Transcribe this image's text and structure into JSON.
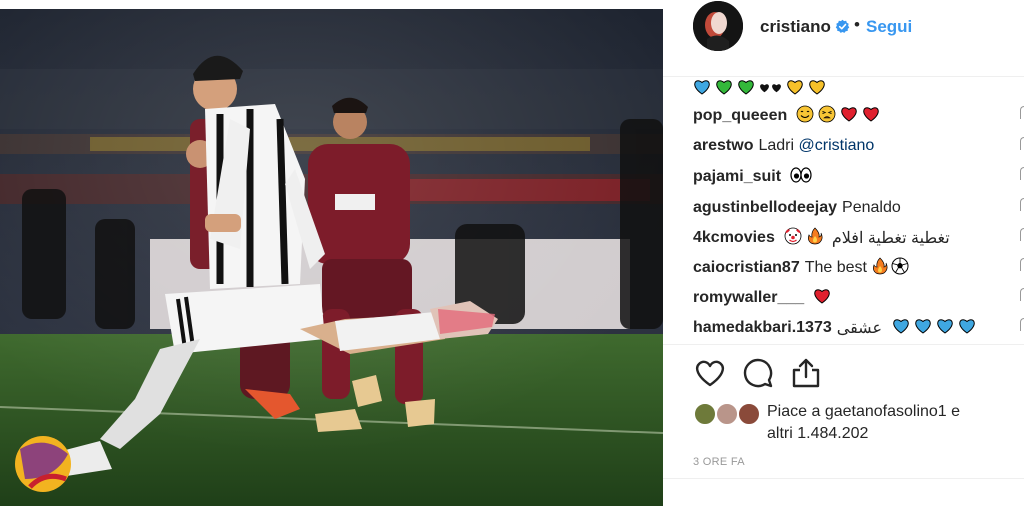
{
  "header": {
    "username": "cristiano",
    "separator": "•",
    "follow_label": "Segui"
  },
  "comments": [
    {
      "user": "",
      "text": "",
      "emojis": [
        "blue-heart",
        "green-heart",
        "green-heart",
        "black-heart",
        "black-heart",
        "yellow-heart",
        "yellow-heart"
      ]
    },
    {
      "user": "pop_queeen",
      "text": "",
      "emojis": [
        "grin-face",
        "weary-face",
        "red-heart",
        "red-heart"
      ]
    },
    {
      "user": "arestwo",
      "text": "Ladri ",
      "mention": "@cristiano",
      "emojis": []
    },
    {
      "user": "pajami_suit",
      "text": "",
      "emojis": [
        "eyes"
      ]
    },
    {
      "user": "agustinbellodeejay",
      "text": "Penaldo",
      "emojis": []
    },
    {
      "user": "4kcmovies",
      "text": "تغطية تغطية افلام",
      "emojis": [
        "clown-face",
        "fire"
      ]
    },
    {
      "user": "caiocristian87",
      "text": "The best",
      "emojis": [
        "fire",
        "soccer-ball"
      ]
    },
    {
      "user": "romywaller___",
      "text": "",
      "emojis": [
        "red-heart"
      ]
    },
    {
      "user": "hamedakbari.1373",
      "text": "عشقی",
      "emojis": [
        "blue-heart",
        "blue-heart",
        "blue-heart",
        "blue-heart"
      ]
    }
  ],
  "actions": {
    "like_icon": "heart-outline-icon",
    "comment_icon": "comment-bubble-icon",
    "share_icon": "share-upload-icon"
  },
  "likes": {
    "line1": "Piace a gaetanofasolino1 e",
    "line2": "altri 1.484.202"
  },
  "timestamp": "3 ORE FA",
  "colors": {
    "link_blue": "#3897f0",
    "text_dark": "#262626",
    "muted": "#999999",
    "verified": "#3897f0"
  }
}
